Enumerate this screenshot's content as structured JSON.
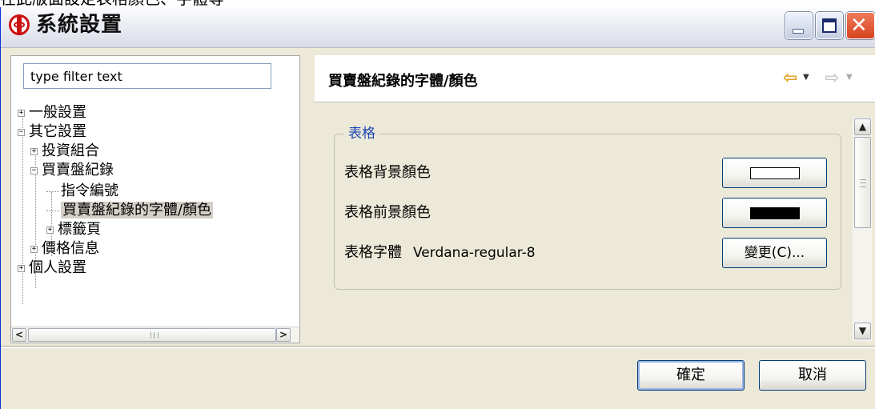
{
  "caption": "在此版面設定表格顏色、字體等",
  "window": {
    "title": "系統設置",
    "min_label": "_",
    "max_label": "□",
    "close_label": "✕"
  },
  "filter": {
    "placeholder": "type filter text",
    "value": "type filter text"
  },
  "tree": {
    "items": [
      {
        "label": "一般設置",
        "expander": "+"
      },
      {
        "label": "其它設置",
        "expander": "−"
      },
      {
        "label": "投資組合",
        "expander": "+"
      },
      {
        "label": "買賣盤紀錄",
        "expander": "−"
      },
      {
        "label": "指令編號"
      },
      {
        "label": "買賣盤紀錄的字體/顏色",
        "selected": true
      },
      {
        "label": "標籤頁",
        "expander": "+"
      },
      {
        "label": "價格信息",
        "expander": "+"
      },
      {
        "label": "個人設置",
        "expander": "+"
      }
    ]
  },
  "hscroll": {
    "left": "<",
    "right": ">"
  },
  "page": {
    "title": "買賣盤紀錄的字體/顏色",
    "nav_back_icon": "⇦",
    "nav_fwd_icon": "⇨",
    "dropdown_icon": "▼"
  },
  "group": {
    "legend": "表格",
    "bg_color_label": "表格背景顏色",
    "bg_color": "#ffffff",
    "fg_color_label": "表格前景顏色",
    "fg_color": "#000000",
    "font_label": "表格字體",
    "font_value": "Verdana-regular-8",
    "change_button": "變更(C)..."
  },
  "vscroll": {
    "up": "▲",
    "down": "▼"
  },
  "footer": {
    "ok": "確定",
    "cancel": "取消"
  }
}
